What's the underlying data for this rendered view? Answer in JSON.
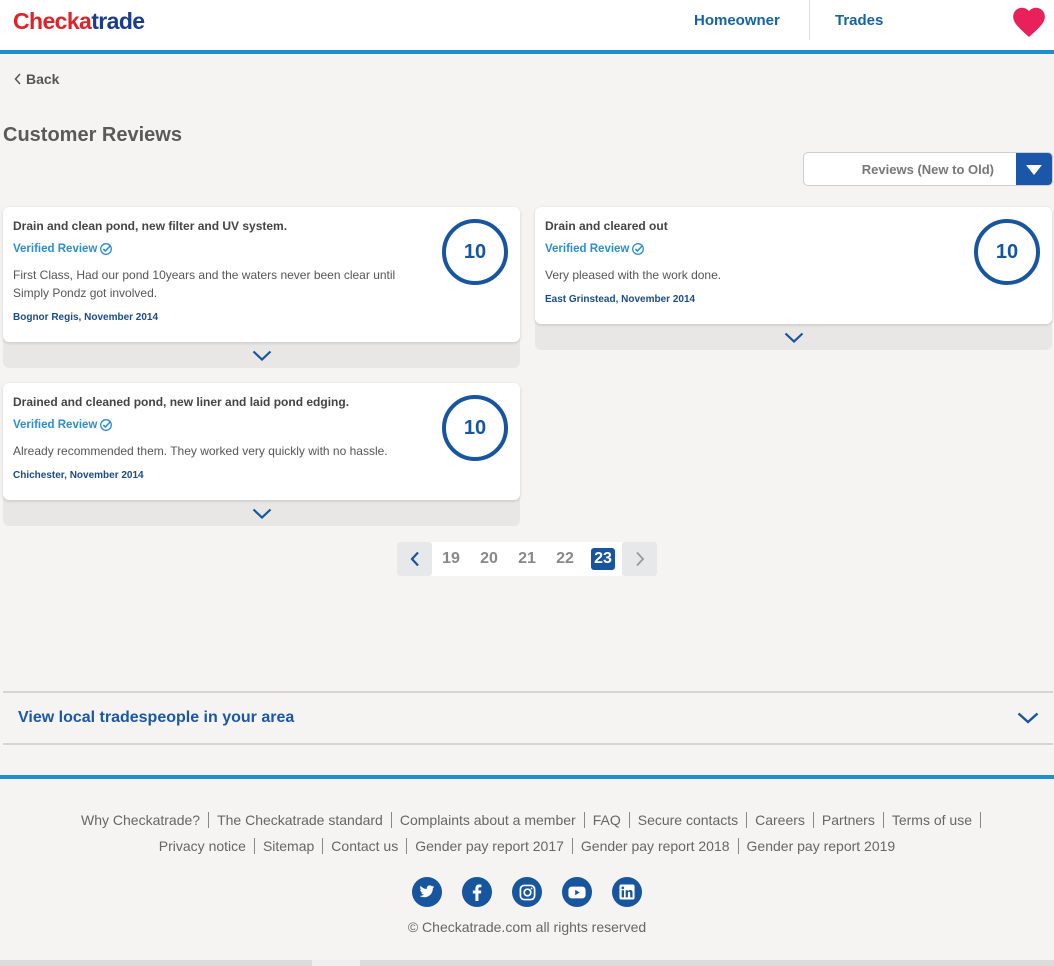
{
  "header": {
    "logo_part1": "Check",
    "logo_part2": "a",
    "logo_part3": "trade",
    "nav": [
      {
        "label": "Homeowner"
      },
      {
        "label": "Trades"
      }
    ],
    "favourites_icon": "heart-icon"
  },
  "back_label": "Back",
  "page_title": "Customer Reviews",
  "sort": {
    "selected": "Reviews (New to Old)"
  },
  "reviews": [
    {
      "title": "Drain and clean pond, new filter and UV system.",
      "verified": "Verified Review",
      "body": "First Class, Had our pond 10years and the waters never been clear until Simply Pondz got involved.",
      "location": "Bognor Regis, November 2014",
      "score": "10"
    },
    {
      "title": "Drain and cleared out",
      "verified": "Verified Review",
      "body": "Very pleased with the work done.",
      "location": "East Grinstead, November 2014",
      "score": "10"
    },
    {
      "title": "Drained and cleaned pond, new liner and laid pond edging.",
      "verified": "Verified Review",
      "body": "Already recommended them. They worked very quickly with no hassle.",
      "location": "Chichester, November 2014",
      "score": "10"
    }
  ],
  "pagination": {
    "pages": [
      "19",
      "20",
      "21",
      "22",
      "23"
    ],
    "current": "23"
  },
  "accordion": {
    "label": "View local tradespeople in your area"
  },
  "footer": {
    "links_row1": [
      "Why Checkatrade?",
      "The Checkatrade standard",
      "Complaints about a member",
      "FAQ",
      "Secure contacts",
      "Careers",
      "Partners",
      "Terms of use"
    ],
    "links_row2": [
      "Privacy notice",
      "Sitemap",
      "Contact us",
      "Gender pay report 2017",
      "Gender pay report 2018",
      "Gender pay report 2019"
    ],
    "socials": [
      "twitter-icon",
      "facebook-icon",
      "instagram-icon",
      "youtube-icon",
      "linkedin-icon"
    ],
    "copyright": "© Checkatrade.com all rights reserved"
  },
  "colors": {
    "brand_blue": "#17559f",
    "accent_blue": "#1d8fcf",
    "brand_red": "#e0232b",
    "heart_pink": "#e8215a"
  }
}
